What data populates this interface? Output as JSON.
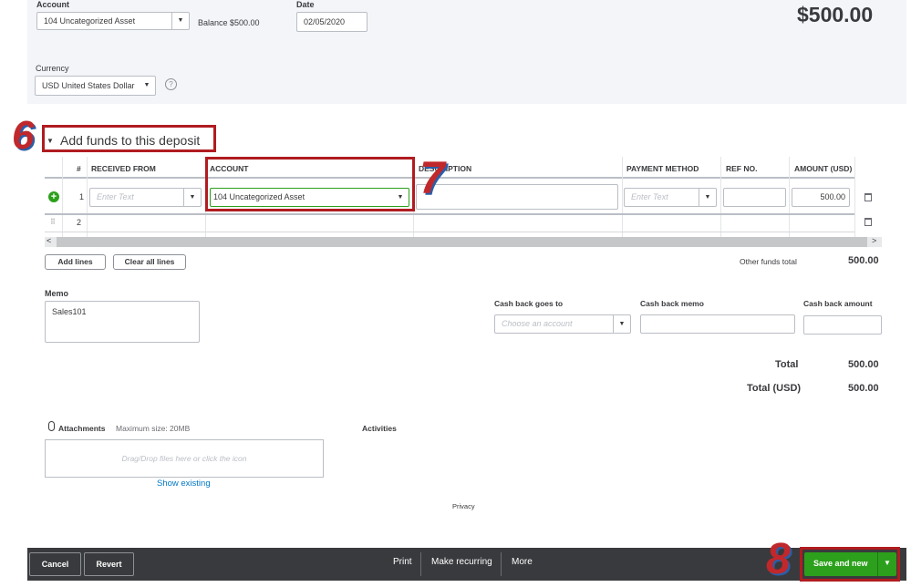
{
  "header": {
    "account_label": "Account",
    "account_value": "104 Uncategorized Asset",
    "balance_text": "Balance $500.00",
    "date_label": "Date",
    "date_value": "02/05/2020",
    "amount_display": "$500.00",
    "currency_label": "Currency",
    "currency_value": "USD United States Dollar",
    "help_icon": "?"
  },
  "section": {
    "title": "Add funds to this deposit",
    "toggle_icon": "▼"
  },
  "table": {
    "headers": [
      "#",
      "RECEIVED FROM",
      "ACCOUNT",
      "DESCRIPTION",
      "PAYMENT METHOD",
      "REF NO.",
      "AMOUNT (USD)"
    ],
    "rows": [
      {
        "num": "1",
        "received_from_placeholder": "Enter Text",
        "account": "104 Uncategorized Asset",
        "payment_placeholder": "Enter Text",
        "amount": "500.00"
      },
      {
        "num": "2"
      }
    ]
  },
  "buttons": {
    "add_lines": "Add lines",
    "clear_lines": "Clear all lines"
  },
  "totals": {
    "other_funds_label": "Other funds total",
    "other_funds_value": "500.00",
    "total_label": "Total",
    "total_value": "500.00",
    "total_usd_label": "Total (USD)",
    "total_usd_value": "500.00"
  },
  "memo": {
    "label": "Memo",
    "value": "Sales101"
  },
  "cashback": {
    "goes_to_label": "Cash back goes to",
    "goes_to_placeholder": "Choose an account",
    "memo_label": "Cash back memo",
    "amount_label": "Cash back amount"
  },
  "attachments": {
    "label": "Attachments",
    "max_size": "Maximum size: 20MB",
    "drop_text": "Drag/Drop files here or click the icon",
    "show_existing": "Show existing",
    "activities_label": "Activities"
  },
  "privacy": "Privacy",
  "footer": {
    "cancel": "Cancel",
    "revert": "Revert",
    "print": "Print",
    "make_recurring": "Make recurring",
    "more": "More",
    "save_new": "Save and new"
  },
  "annotations": {
    "step6": "6",
    "step7": "7",
    "step8": "8",
    "color": "#b01c20"
  },
  "colors": {
    "accent_green": "#2ca01c",
    "footer_bg": "#393a3d",
    "link_blue": "#0077c5"
  }
}
